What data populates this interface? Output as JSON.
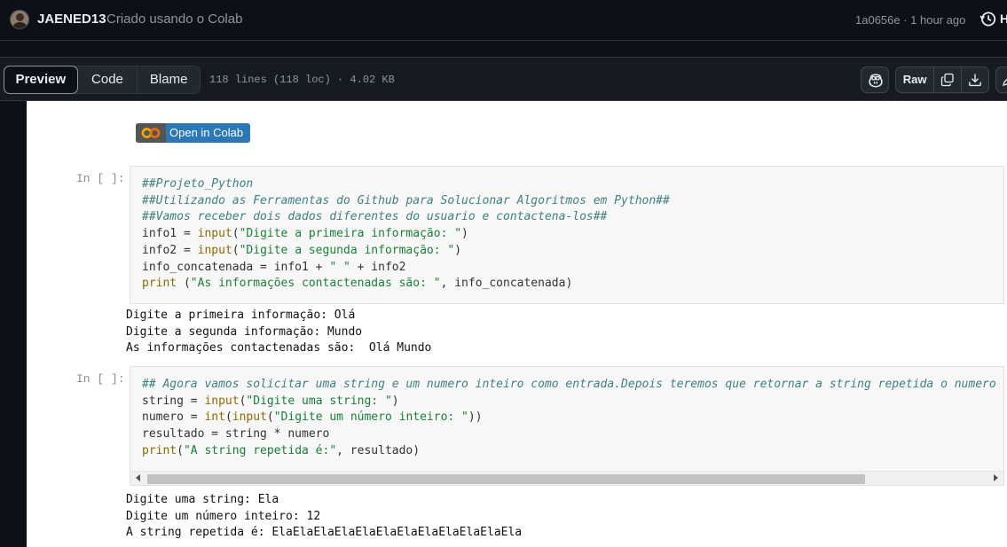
{
  "header": {
    "author": "JAENED13",
    "commit_message": "Criado usando o Colab",
    "commit_meta": "1a0656e · 1 hour ago",
    "history_label": "H"
  },
  "toolbar": {
    "tabs": [
      {
        "label": "Preview",
        "active": true
      },
      {
        "label": "Code",
        "active": false
      },
      {
        "label": "Blame",
        "active": false
      }
    ],
    "file_info": "118 lines (118 loc) · 4.02 KB",
    "raw_label": "Raw"
  },
  "notebook": {
    "badge_text": "Open in Colab",
    "cells": [
      {
        "prompt": "In [ ]:",
        "code": [
          [
            {
              "t": "cm",
              "v": "##Projeto_Python"
            }
          ],
          [
            {
              "t": "cm",
              "v": "##Utilizando as Ferramentas do Github para Solucionar Algoritmos em Python##"
            }
          ],
          [
            {
              "t": "cm",
              "v": "##Vamos receber dois dados diferentes do usuario e contactena-los##"
            }
          ],
          [
            {
              "t": "tx",
              "v": "info1 = "
            },
            {
              "t": "kw",
              "v": "input"
            },
            {
              "t": "tx",
              "v": "("
            },
            {
              "t": "st",
              "v": "\"Digite a primeira informação: \""
            },
            {
              "t": "tx",
              "v": ")"
            }
          ],
          [
            {
              "t": "tx",
              "v": "info2 = "
            },
            {
              "t": "kw",
              "v": "input"
            },
            {
              "t": "tx",
              "v": "("
            },
            {
              "t": "st",
              "v": "\"Digite a segunda informação: \""
            },
            {
              "t": "tx",
              "v": ")"
            }
          ],
          [
            {
              "t": "tx",
              "v": "info_concatenada = info1 + "
            },
            {
              "t": "st",
              "v": "\" \""
            },
            {
              "t": "tx",
              "v": " + info2"
            }
          ],
          [
            {
              "t": "kw",
              "v": "print"
            },
            {
              "t": "tx",
              "v": " ("
            },
            {
              "t": "st",
              "v": "\"As informações contactenadas são: \""
            },
            {
              "t": "tx",
              "v": ", info_concatenada)"
            }
          ]
        ],
        "output": [
          "Digite a primeira informação: Olá",
          "Digite a segunda informação: Mundo",
          "As informações contactenadas são:  Olá Mundo"
        ]
      },
      {
        "prompt": "In [ ]:",
        "code": [
          [
            {
              "t": "cm",
              "v": "## Agora vamos solicitar uma string e um numero inteiro como entrada.Depois teremos que retornar a string repetida o numero"
            }
          ],
          [
            {
              "t": "tx",
              "v": "string = "
            },
            {
              "t": "kw",
              "v": "input"
            },
            {
              "t": "tx",
              "v": "("
            },
            {
              "t": "st",
              "v": "\"Digite uma string: \""
            },
            {
              "t": "tx",
              "v": ")"
            }
          ],
          [
            {
              "t": "tx",
              "v": "numero = "
            },
            {
              "t": "kw",
              "v": "int"
            },
            {
              "t": "tx",
              "v": "("
            },
            {
              "t": "kw",
              "v": "input"
            },
            {
              "t": "tx",
              "v": "("
            },
            {
              "t": "st",
              "v": "\"Digite um número inteiro: \""
            },
            {
              "t": "tx",
              "v": "))"
            }
          ],
          [
            {
              "t": "tx",
              "v": "resultado = string * numero"
            }
          ],
          [
            {
              "t": "kw",
              "v": "print"
            },
            {
              "t": "tx",
              "v": "("
            },
            {
              "t": "st",
              "v": "\"A string repetida é:\""
            },
            {
              "t": "tx",
              "v": ", resultado)"
            }
          ]
        ],
        "output": [
          "Digite uma string: Ela",
          "Digite um número inteiro: 12",
          "A string repetida é: ElaElaElaElaElaElaElaElaElaElaElaEla"
        ]
      }
    ]
  }
}
